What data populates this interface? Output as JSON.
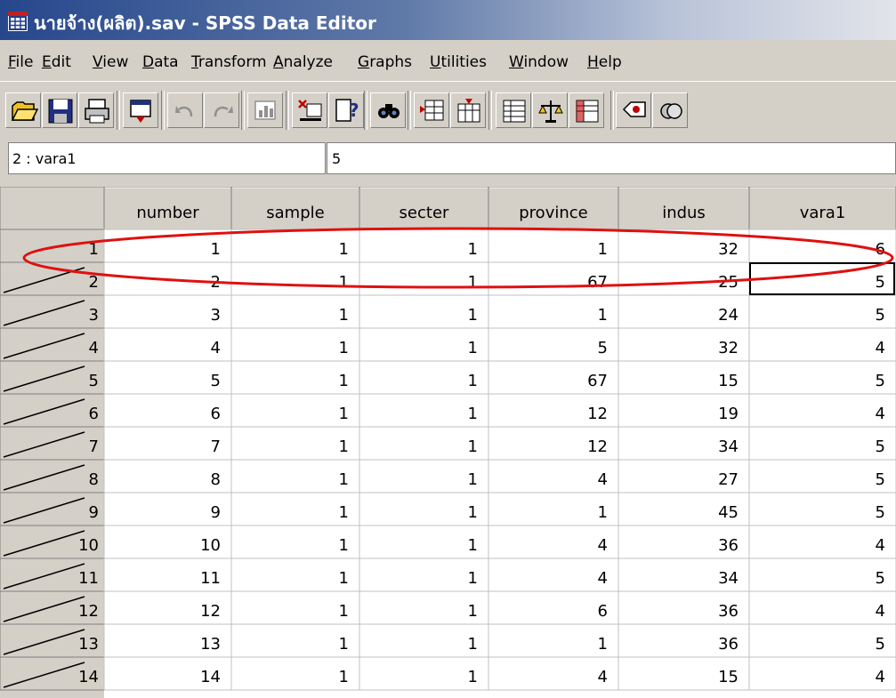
{
  "window": {
    "title": "นายจ้าง(ผลิต).sav - SPSS Data Editor",
    "icon": "spss-grid-icon"
  },
  "menu": [
    "File",
    "Edit",
    "View",
    "Data",
    "Transform",
    "Analyze",
    "Graphs",
    "Utilities",
    "Window",
    "Help"
  ],
  "toolbar": {
    "buttons": [
      "open-file-icon",
      "save-icon",
      "print-icon",
      "dialog-recall-icon",
      "undo-icon",
      "redo-icon",
      "goto-chart-icon",
      "goto-case-icon",
      "variables-icon",
      "find-icon",
      "insert-case-icon",
      "insert-variable-icon",
      "split-file-icon",
      "weight-cases-icon",
      "select-cases-icon",
      "value-labels-icon",
      "use-sets-icon"
    ]
  },
  "cell": {
    "reference": "2 : vara1",
    "value": "5"
  },
  "grid": {
    "columns": [
      "number",
      "sample",
      "secter",
      "province",
      "indus",
      "vara1"
    ],
    "rows": [
      [
        "1",
        "1",
        "1",
        "1",
        "1",
        "32",
        "6"
      ],
      [
        "2",
        "2",
        "1",
        "1",
        "67",
        "25",
        "5"
      ],
      [
        "3",
        "3",
        "1",
        "1",
        "1",
        "24",
        "5"
      ],
      [
        "4",
        "4",
        "1",
        "1",
        "5",
        "32",
        "4"
      ],
      [
        "5",
        "5",
        "1",
        "1",
        "67",
        "15",
        "5"
      ],
      [
        "6",
        "6",
        "1",
        "1",
        "12",
        "19",
        "4"
      ],
      [
        "7",
        "7",
        "1",
        "1",
        "12",
        "34",
        "5"
      ],
      [
        "8",
        "8",
        "1",
        "1",
        "4",
        "27",
        "5"
      ],
      [
        "9",
        "9",
        "1",
        "1",
        "1",
        "45",
        "5"
      ],
      [
        "10",
        "10",
        "1",
        "1",
        "4",
        "36",
        "4"
      ],
      [
        "11",
        "11",
        "1",
        "1",
        "4",
        "34",
        "5"
      ],
      [
        "12",
        "12",
        "1",
        "1",
        "6",
        "36",
        "4"
      ],
      [
        "13",
        "13",
        "1",
        "1",
        "1",
        "36",
        "5"
      ],
      [
        "14",
        "14",
        "1",
        "1",
        "4",
        "15",
        "4"
      ]
    ]
  },
  "annotation": {
    "color": "#e01010"
  },
  "colors": {
    "title_start": "#26478c",
    "selection": "#000000"
  }
}
